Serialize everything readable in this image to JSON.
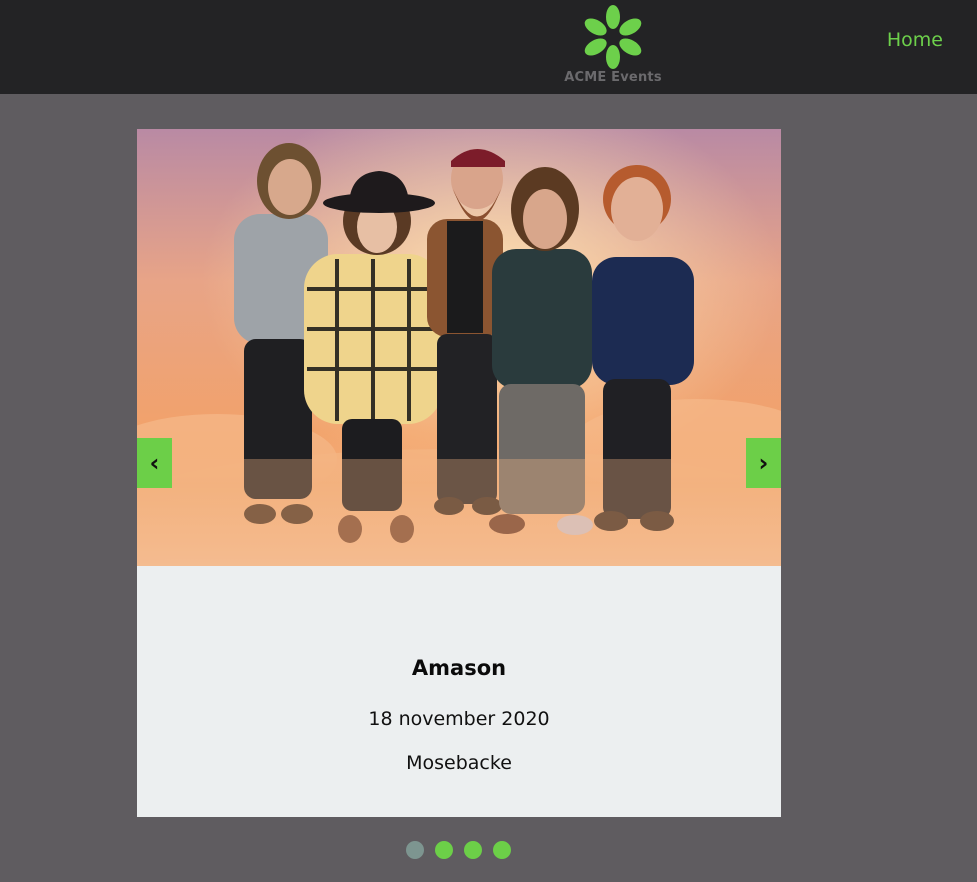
{
  "header": {
    "logo_text": "ACME Events",
    "nav_home": "Home"
  },
  "carousel": {
    "prev_label": "‹",
    "next_label": "›",
    "slide": {
      "title": "Amason",
      "date": "18 november 2020",
      "venue": "Mosebacke"
    },
    "dot_count": 4,
    "active_dot": 0
  },
  "colors": {
    "accent": "#6ccf48",
    "header_bg": "#232325",
    "page_bg": "#5f5c60",
    "card_bg": "#eceff0",
    "dot_active": "#7d9590"
  }
}
